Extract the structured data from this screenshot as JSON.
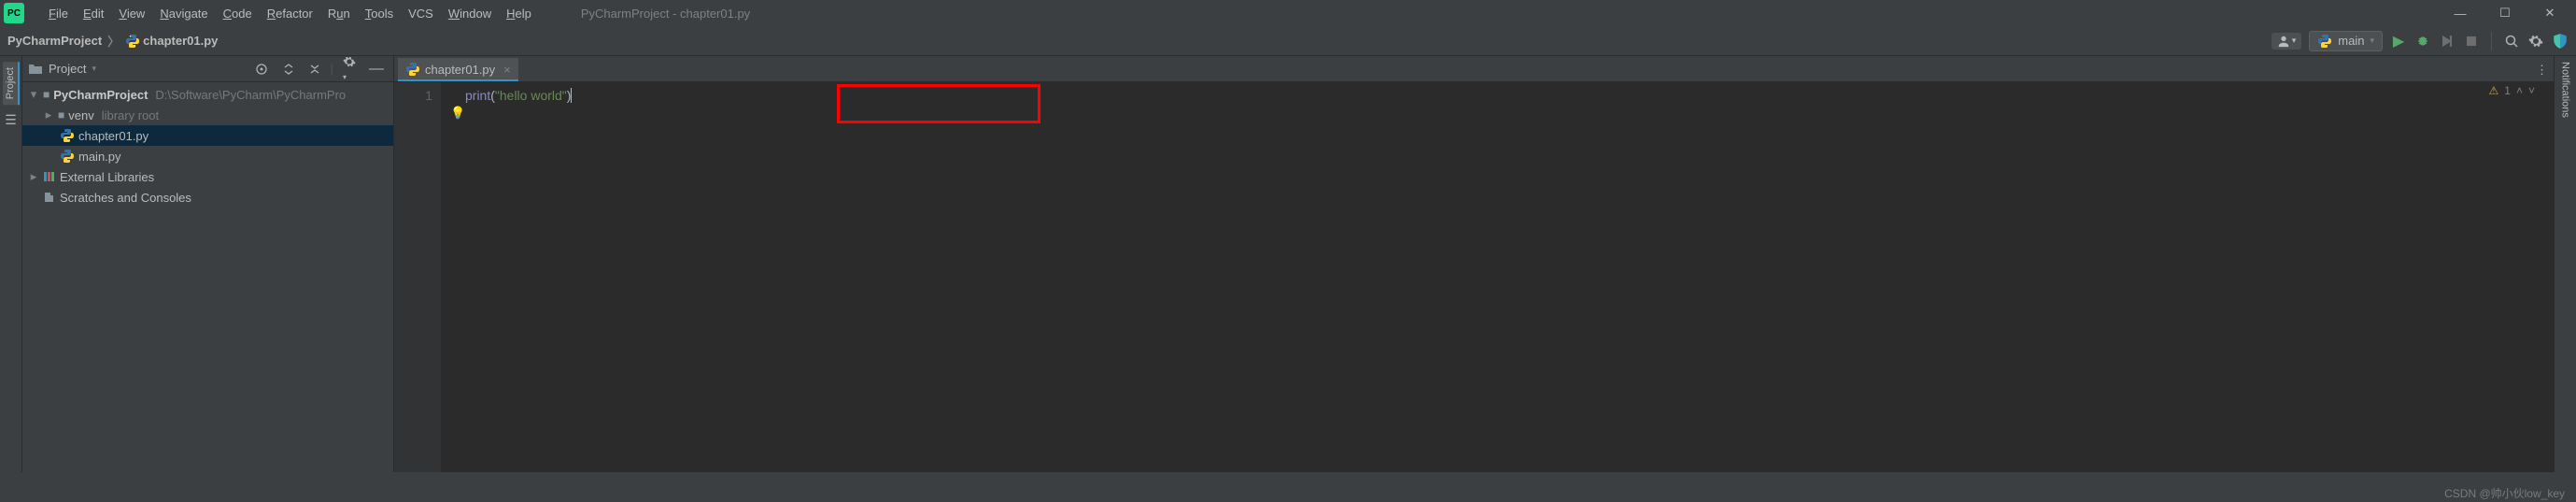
{
  "menu": {
    "file": "File",
    "edit": "Edit",
    "view": "View",
    "navigate": "Navigate",
    "code": "Code",
    "refactor": "Refactor",
    "run": "Run",
    "tools": "Tools",
    "vcs": "VCS",
    "window": "Window",
    "help": "Help"
  },
  "title": "PyCharmProject - chapter01.py",
  "breadcrumb": {
    "project": "PyCharmProject",
    "file": "chapter01.py"
  },
  "run_config": {
    "name": "main"
  },
  "sidebars": {
    "left_project": "Project",
    "left_structure": "Structure",
    "right_notifications": "Notifications"
  },
  "project_panel": {
    "title": "Project",
    "root": {
      "name": "PyCharmProject",
      "path": "D:\\Software\\PyCharm\\PyCharmPro"
    },
    "venv": {
      "name": "venv",
      "hint": "library root"
    },
    "file1": "chapter01.py",
    "file2": "main.py",
    "external": "External Libraries",
    "scratches": "Scratches and Consoles"
  },
  "editor": {
    "tab": "chapter01.py",
    "line_number": "1",
    "code": {
      "func": "print",
      "open": "(",
      "string": "\"hello world\"",
      "close": ")"
    },
    "problems_count": "1"
  },
  "footer": {
    "watermark": "CSDN @帅小伙low_key"
  }
}
